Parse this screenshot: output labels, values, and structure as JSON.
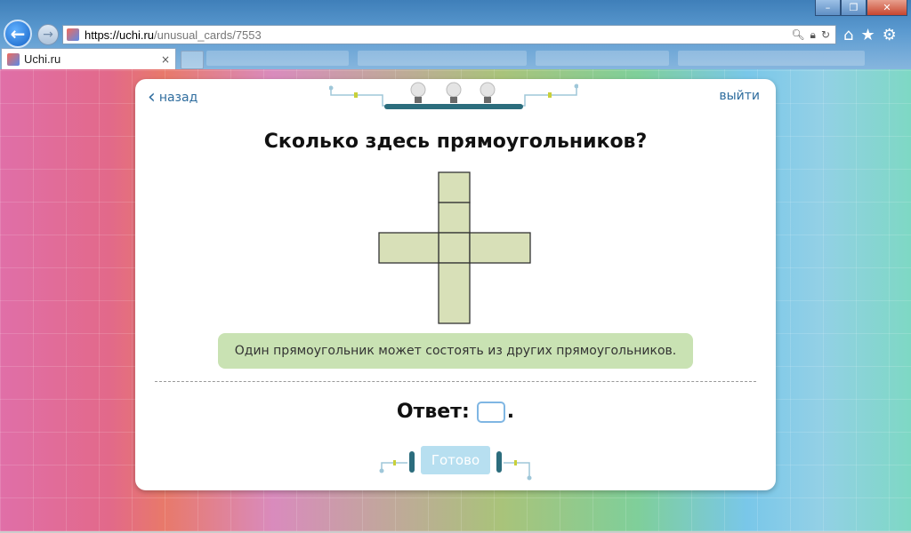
{
  "browser": {
    "url_host": "https://uchi.ru",
    "url_path": "/unusual_cards/7553",
    "tab_title": "Uchi.ru",
    "tab_close": "×",
    "caption": {
      "minimize": "–",
      "restore": "❐",
      "close": "✕"
    },
    "icons": [
      "back-arrow-icon",
      "forward-arrow-icon",
      "search-icon",
      "lock-icon",
      "refresh-icon",
      "home-icon",
      "star-icon",
      "gear-icon"
    ]
  },
  "card": {
    "back_label": "назад",
    "exit_label": "выйти",
    "question": "Сколько здесь прямоугольников?",
    "hint": "Один прямоугольник может состоять из других прямоугольников.",
    "answer_label": "Ответ:",
    "answer_value": "",
    "answer_dot": ".",
    "done_label": "Готово",
    "figure_fill": "#d8e0b8",
    "figure_stroke": "#333333"
  }
}
